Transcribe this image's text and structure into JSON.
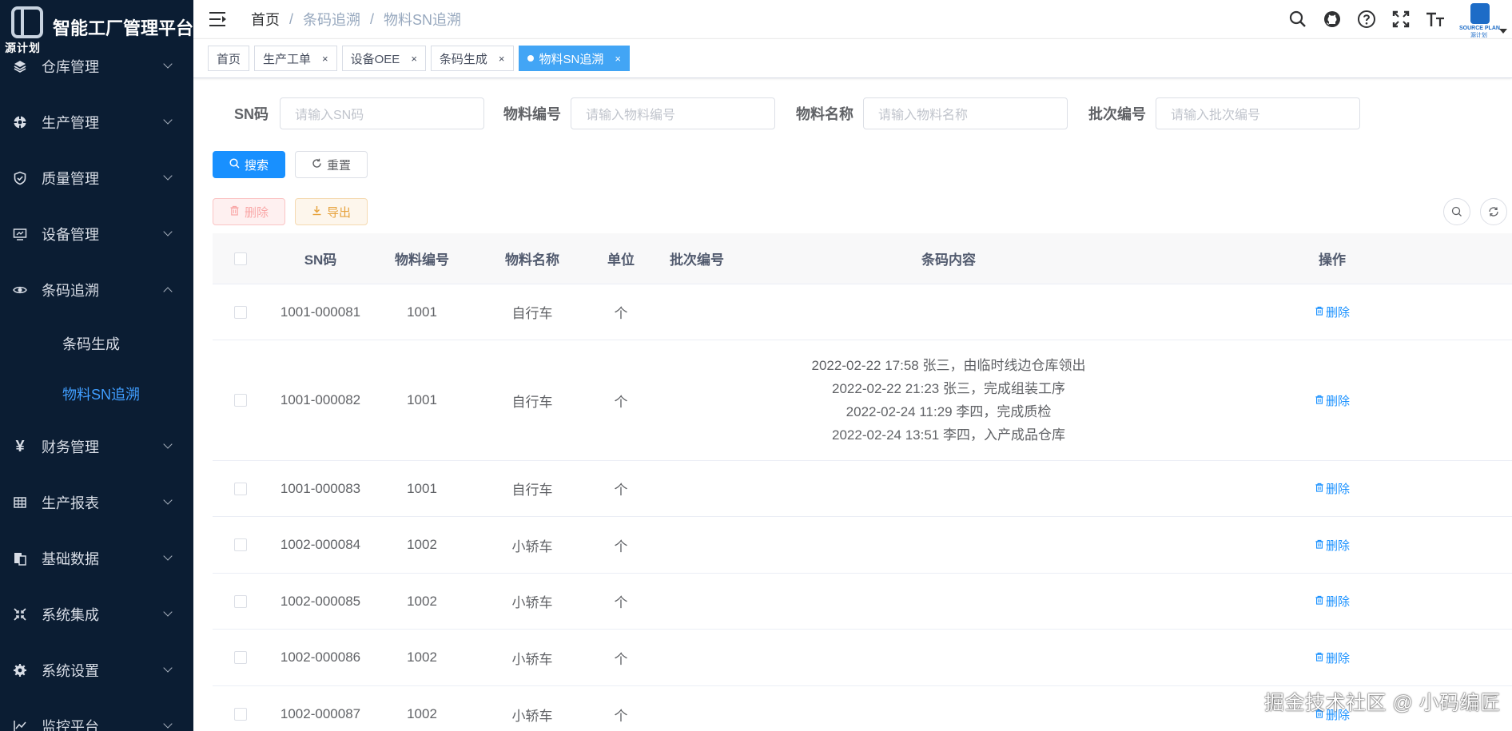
{
  "app": {
    "title": "智能工厂管理平台",
    "logo_caption": "源计划"
  },
  "sidebar": {
    "items": [
      {
        "label": "仓库管理",
        "icon": "layers-icon"
      },
      {
        "label": "生产管理",
        "icon": "production-icon"
      },
      {
        "label": "质量管理",
        "icon": "shield-icon"
      },
      {
        "label": "设备管理",
        "icon": "monitor-icon"
      },
      {
        "label": "条码追溯",
        "icon": "eye-icon",
        "expanded": true,
        "children": [
          {
            "label": "条码生成"
          },
          {
            "label": "物料SN追溯",
            "active": true
          }
        ]
      },
      {
        "label": "财务管理",
        "icon": "yen-icon"
      },
      {
        "label": "生产报表",
        "icon": "table-icon"
      },
      {
        "label": "基础数据",
        "icon": "data-icon"
      },
      {
        "label": "系统集成",
        "icon": "integration-icon"
      },
      {
        "label": "系统设置",
        "icon": "gear-icon"
      },
      {
        "label": "监控平台",
        "icon": "chart-icon"
      }
    ]
  },
  "navbar": {
    "breadcrumb": [
      "首页",
      "条码追溯",
      "物料SN追溯"
    ],
    "avatar_caption_1": "SOURCE PLAN",
    "avatar_caption_2": "源计划"
  },
  "tags": [
    {
      "label": "首页",
      "closable": false
    },
    {
      "label": "生产工单",
      "closable": true
    },
    {
      "label": "设备OEE",
      "closable": true
    },
    {
      "label": "条码生成",
      "closable": true
    },
    {
      "label": "物料SN追溯",
      "closable": true,
      "active": true
    }
  ],
  "tag_close": "×",
  "search": {
    "sn_label": "SN码",
    "sn_placeholder": "请输入SN码",
    "code_label": "物料编号",
    "code_placeholder": "请输入物料编号",
    "name_label": "物料名称",
    "name_placeholder": "请输入物料名称",
    "batch_label": "批次编号",
    "batch_placeholder": "请输入批次编号",
    "search_btn": "搜索",
    "reset_btn": "重置"
  },
  "toolbar": {
    "delete_btn": "删除",
    "export_btn": "导出"
  },
  "table": {
    "headers": [
      "SN码",
      "物料编号",
      "物料名称",
      "单位",
      "批次编号",
      "条码内容",
      "操作"
    ],
    "op_label": "删除",
    "rows": [
      {
        "sn": "1001-000081",
        "code": "1001",
        "name": "自行车",
        "unit": "个",
        "batch": "",
        "content": []
      },
      {
        "sn": "1001-000082",
        "code": "1001",
        "name": "自行车",
        "unit": "个",
        "batch": "",
        "content": [
          "2022-02-22 17:58 张三，由临时线边仓库领出",
          "2022-02-22 21:23 张三，完成组装工序",
          "2022-02-24 11:29 李四，完成质检",
          "2022-02-24 13:51 李四，入产成品仓库"
        ]
      },
      {
        "sn": "1001-000083",
        "code": "1001",
        "name": "自行车",
        "unit": "个",
        "batch": "",
        "content": []
      },
      {
        "sn": "1002-000084",
        "code": "1002",
        "name": "小轿车",
        "unit": "个",
        "batch": "",
        "content": []
      },
      {
        "sn": "1002-000085",
        "code": "1002",
        "name": "小轿车",
        "unit": "个",
        "batch": "",
        "content": []
      },
      {
        "sn": "1002-000086",
        "code": "1002",
        "name": "小轿车",
        "unit": "个",
        "batch": "",
        "content": []
      },
      {
        "sn": "1002-000087",
        "code": "1002",
        "name": "小轿车",
        "unit": "个",
        "batch": "",
        "content": []
      }
    ]
  },
  "watermark": "掘金技术社区 @ 小码编匠"
}
